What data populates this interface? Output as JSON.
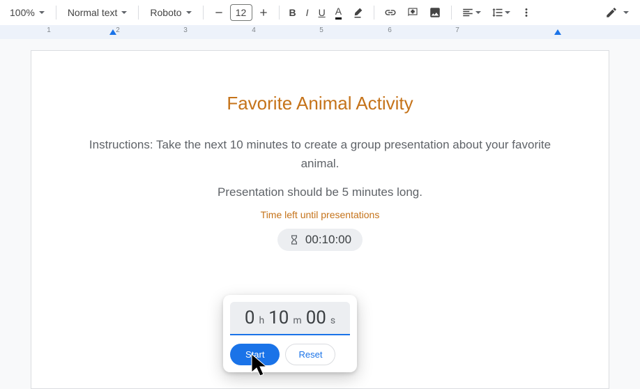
{
  "toolbar": {
    "zoom": "100%",
    "style": "Normal text",
    "font": "Roboto",
    "font_size": "12",
    "bold_label": "B",
    "italic_label": "I",
    "underline_label": "U",
    "text_color_label": "A"
  },
  "ruler": {
    "numbers": [
      "1",
      "2",
      "3",
      "4",
      "5",
      "6",
      "7"
    ]
  },
  "doc": {
    "title": "Favorite Animal Activity",
    "instruction": "Instructions: Take the next 10 minutes to create a group presentation about your favorite animal.",
    "subtext": "Presentation should be 5 minutes long.",
    "timer_label": "Time left until presentations",
    "timer_value": "00:10:00"
  },
  "timer_popup": {
    "hours": "0",
    "hours_unit": "h",
    "minutes": "10",
    "minutes_unit": "m",
    "seconds": "00",
    "seconds_unit": "s",
    "start_label": "Start",
    "reset_label": "Reset"
  }
}
